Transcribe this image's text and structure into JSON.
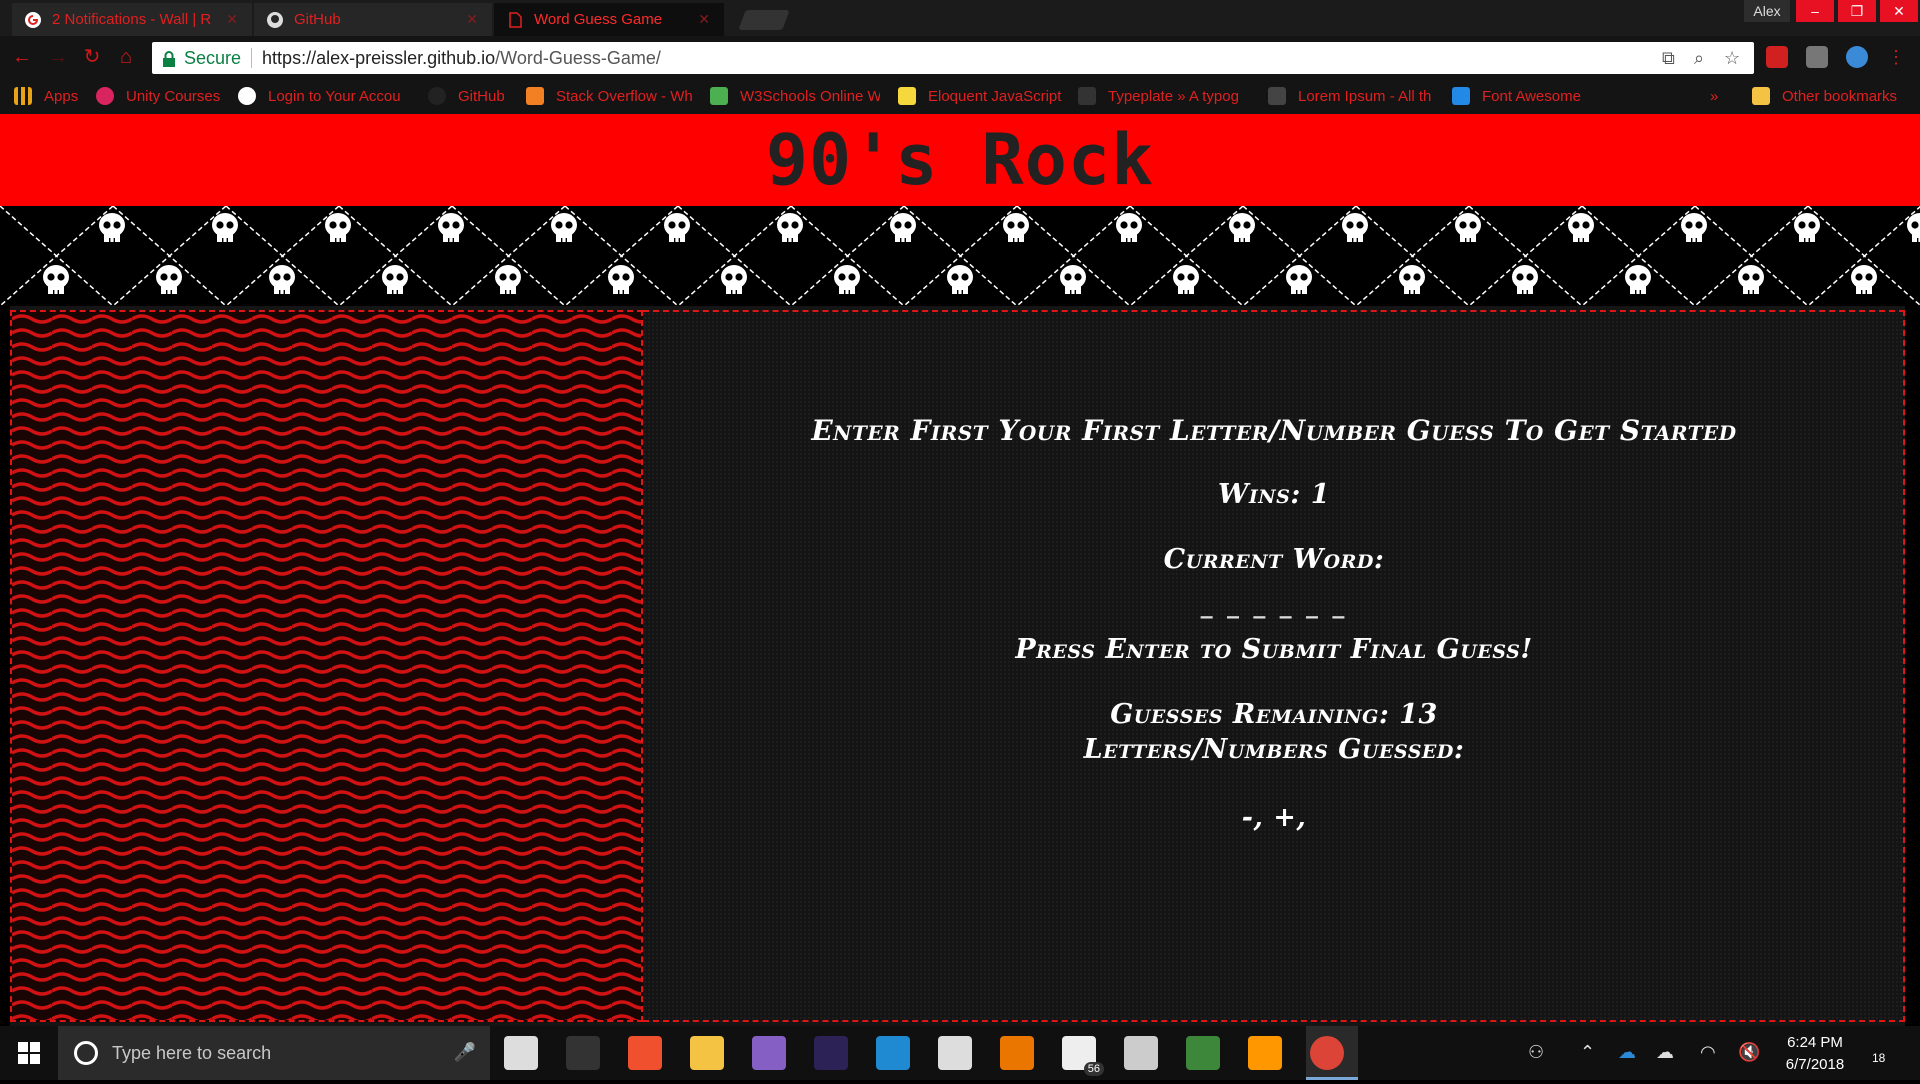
{
  "browser": {
    "tabs": [
      {
        "title": "2 Notifications - Wall | R",
        "active": false
      },
      {
        "title": "GitHub",
        "active": false
      },
      {
        "title": "Word Guess Game",
        "active": true
      }
    ],
    "profile_name": "Alex",
    "window_controls": {
      "minimize": "–",
      "restore": "❐",
      "close": "✕"
    },
    "nav": {
      "back": "←",
      "forward": "→",
      "reload": "↻",
      "home": "⌂"
    },
    "omnibox": {
      "secure_label": "Secure",
      "url_host": "https://alex-preissler.github.io",
      "url_path": "/Word-Guess-Game/"
    },
    "bookmarks": [
      {
        "label": "Apps",
        "icon": "apps-grid-icon",
        "color": "#e8a317"
      },
      {
        "label": "Unity Courses",
        "icon": "unity-icon",
        "color": "#d9255d"
      },
      {
        "label": "Login to Your Accou",
        "icon": "google-icon",
        "color": "#ffffff"
      },
      {
        "label": "GitHub",
        "icon": "github-icon",
        "color": "#222222"
      },
      {
        "label": "Stack Overflow - Wh",
        "icon": "stackoverflow-icon",
        "color": "#f48024"
      },
      {
        "label": "W3Schools Online W",
        "icon": "w3schools-icon",
        "color": "#4caf50"
      },
      {
        "label": "Eloquent JavaScript",
        "icon": "ejs-icon",
        "color": "#f7d83c"
      },
      {
        "label": "Typeplate » A typog",
        "icon": "typeplate-icon",
        "color": "#333333"
      },
      {
        "label": "Lorem Ipsum - All th",
        "icon": "lorem-icon",
        "color": "#444444"
      },
      {
        "label": "Font Awesome",
        "icon": "fontawesome-icon",
        "color": "#228ae6"
      }
    ],
    "bookmarks_overflow": "»",
    "other_bookmarks": "Other bookmarks"
  },
  "page": {
    "title": "90's Rock",
    "instructions": "Enter First Your First Letter/Number Guess To Get Started",
    "wins_label": "Wins: ",
    "wins_value": "1",
    "current_word_label": "Current Word:",
    "word_blanks": "_ _ _ _ _ _",
    "submit_hint": "Press Enter to Submit Final Guess!",
    "remaining_label": "Guesses Remaining: ",
    "remaining_value": "13",
    "guessed_label": "Letters/Numbers Guessed:",
    "guessed_letters": "-, +,",
    "colors": {
      "banner": "#ff0000",
      "accent_border": "#e01515",
      "panel_bg": "#141414"
    }
  },
  "taskbar": {
    "search_placeholder": "Type here to search",
    "apps": [
      {
        "name": "task-view-icon",
        "color": "#dddddd"
      },
      {
        "name": "terminal-icon",
        "color": "#333333"
      },
      {
        "name": "git-icon",
        "color": "#f1502f"
      },
      {
        "name": "file-explorer-icon",
        "color": "#f5c343"
      },
      {
        "name": "visual-studio-icon",
        "color": "#865fc5"
      },
      {
        "name": "eclipse-icon",
        "color": "#2c2255"
      },
      {
        "name": "vscode-icon",
        "color": "#1f8ad2"
      },
      {
        "name": "unity-editor-icon",
        "color": "#dddddd"
      },
      {
        "name": "blender-icon",
        "color": "#ea7600"
      },
      {
        "name": "mail-icon",
        "color": "#eeeeee"
      },
      {
        "name": "github-desktop-icon",
        "color": "#cccccc"
      },
      {
        "name": "node-icon",
        "color": "#3c873a"
      },
      {
        "name": "sublime-icon",
        "color": "#ff9800"
      },
      {
        "name": "chrome-icon",
        "color": "#db4437"
      }
    ],
    "mail_badge": "56",
    "clock_time": "6:24 PM",
    "clock_date": "6/7/2018",
    "notification_count": "18"
  }
}
